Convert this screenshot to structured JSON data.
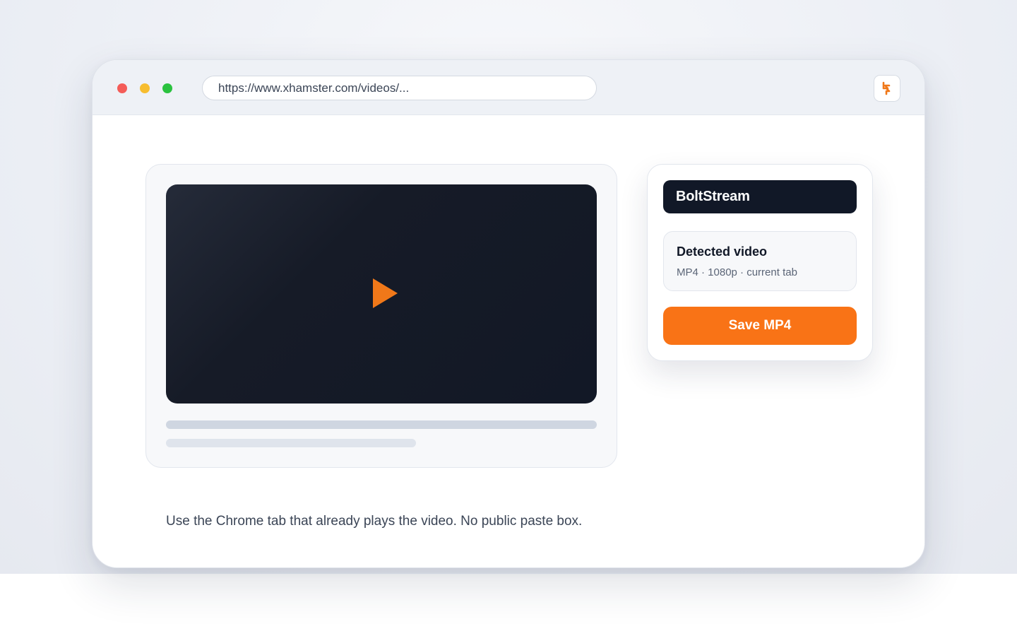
{
  "browser": {
    "url": "https://www.xhamster.com/videos/...",
    "extension_icon": "bolt-icon",
    "window_controls": [
      "close-dot",
      "minimize-dot",
      "maximize-dot"
    ]
  },
  "video": {
    "play_icon": "play-icon"
  },
  "popup": {
    "brand": "BoltStream",
    "detected_title": "Detected video",
    "detected_meta": "MP4 · 1080p · current tab",
    "save_label": "Save MP4"
  },
  "caption": "Use the Chrome tab that already plays the video. No public paste box.",
  "colors": {
    "accent": "#f97316",
    "header_dark": "#111827",
    "player_bg": "#121826"
  }
}
